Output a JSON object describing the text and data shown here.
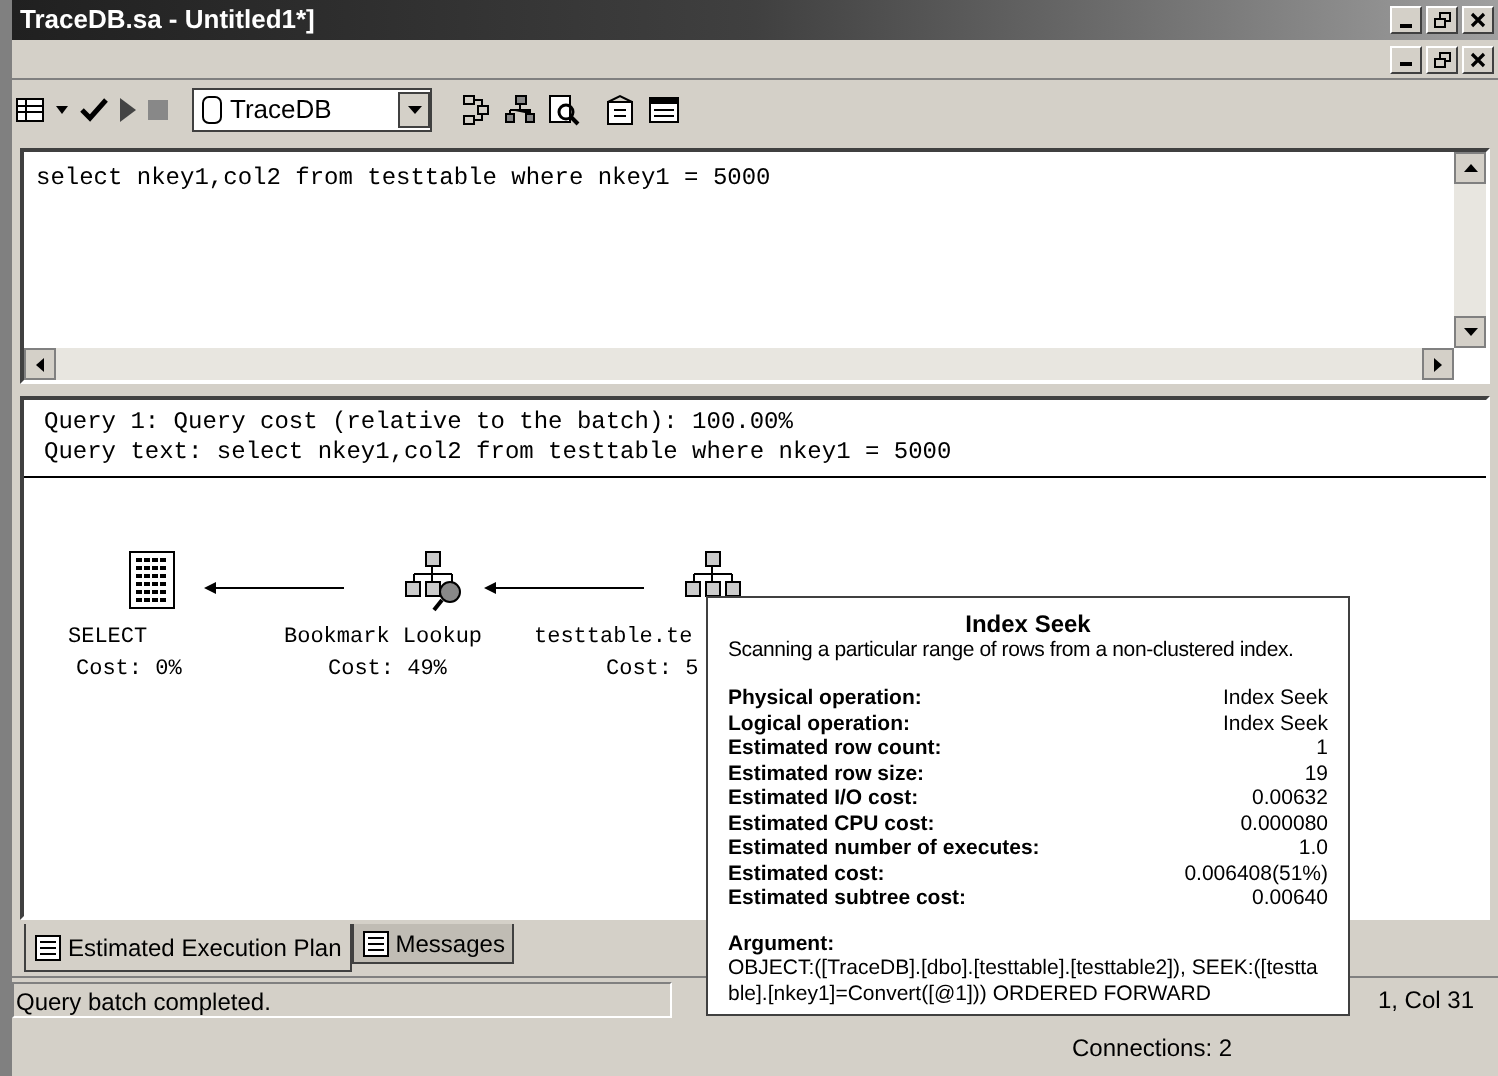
{
  "window": {
    "title": "TraceDB.sa - Untitled1*]"
  },
  "toolbar": {
    "database": "TraceDB"
  },
  "editor": {
    "query": "select nkey1,col2 from testtable where nkey1 = 5000"
  },
  "results": {
    "header": [
      "Query 1: Query cost (relative to the batch): 100.00%",
      "Query text: select nkey1,col2 from testtable where nkey1 = 5000"
    ],
    "plan_nodes": [
      {
        "kind": "select",
        "label": "SELECT",
        "cost": "Cost: 0%"
      },
      {
        "kind": "lookup",
        "label": "Bookmark Lookup",
        "cost": "Cost: 49%"
      },
      {
        "kind": "seek",
        "label": "testtable.te",
        "cost": "Cost: 5"
      }
    ]
  },
  "tooltip": {
    "title": "Index Seek",
    "description": "Scanning a particular range of rows from a non-clustered index.",
    "rows": [
      {
        "label": "Physical operation:",
        "value": "Index Seek"
      },
      {
        "label": "Logical operation:",
        "value": "Index Seek"
      },
      {
        "label": "Estimated row count:",
        "value": "1"
      },
      {
        "label": "Estimated row size:",
        "value": "19"
      },
      {
        "label": "Estimated I/O cost:",
        "value": "0.00632"
      },
      {
        "label": "Estimated CPU cost:",
        "value": "0.000080"
      },
      {
        "label": "Estimated number of executes:",
        "value": "1.0"
      },
      {
        "label": "Estimated cost:",
        "value": "0.006408(51%)"
      },
      {
        "label": "Estimated subtree cost:",
        "value": "0.00640"
      }
    ],
    "argument_label": "Argument:",
    "argument": "OBJECT:([TraceDB].[dbo].[testtable].[testtable2]), SEEK:([testtable].[nkey1]=Convert([@1])) ORDERED FORWARD"
  },
  "tabs": [
    {
      "label": "Estimated Execution Plan",
      "selected": true
    },
    {
      "label": "Messages",
      "selected": false
    }
  ],
  "status_bar": {
    "message": "Query batch completed.",
    "position": "1, Col 31",
    "connections": "Connections: 2"
  }
}
